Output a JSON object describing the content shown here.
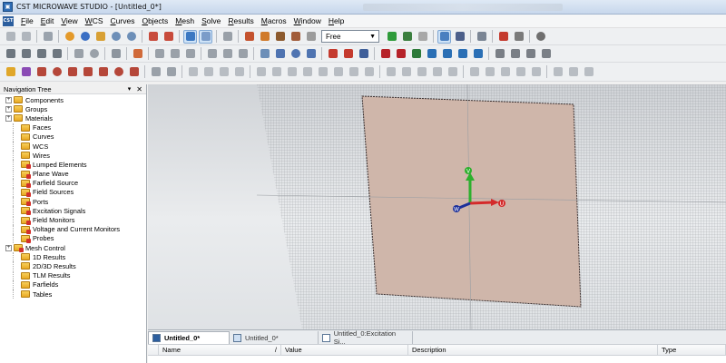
{
  "window": {
    "title": "CST MICROWAVE STUDIO - [Untitled_0*]",
    "app_icon": "cst-app-icon"
  },
  "menubar": {
    "items": [
      "File",
      "Edit",
      "View",
      "WCS",
      "Curves",
      "Objects",
      "Mesh",
      "Solve",
      "Results",
      "Macros",
      "Window",
      "Help"
    ]
  },
  "toolbar": {
    "view_mode_select": "Free"
  },
  "navigation_tree": {
    "title": "Navigation Tree",
    "items": [
      {
        "label": "Components",
        "expandable": true,
        "mark": false
      },
      {
        "label": "Groups",
        "expandable": true,
        "mark": false
      },
      {
        "label": "Materials",
        "expandable": true,
        "mark": false
      },
      {
        "label": "Faces",
        "expandable": false,
        "mark": false
      },
      {
        "label": "Curves",
        "expandable": false,
        "mark": false
      },
      {
        "label": "WCS",
        "expandable": false,
        "mark": false
      },
      {
        "label": "Wires",
        "expandable": false,
        "mark": false
      },
      {
        "label": "Lumped Elements",
        "expandable": false,
        "mark": true
      },
      {
        "label": "Plane Wave",
        "expandable": false,
        "mark": true
      },
      {
        "label": "Farfield Source",
        "expandable": false,
        "mark": true
      },
      {
        "label": "Field Sources",
        "expandable": false,
        "mark": true
      },
      {
        "label": "Ports",
        "expandable": false,
        "mark": true
      },
      {
        "label": "Excitation Signals",
        "expandable": false,
        "mark": true
      },
      {
        "label": "Field Monitors",
        "expandable": false,
        "mark": true
      },
      {
        "label": "Voltage and Current Monitors",
        "expandable": false,
        "mark": true
      },
      {
        "label": "Probes",
        "expandable": false,
        "mark": true
      },
      {
        "label": "Mesh Control",
        "expandable": true,
        "mark": true
      },
      {
        "label": "1D Results",
        "expandable": false,
        "mark": false
      },
      {
        "label": "2D/3D Results",
        "expandable": false,
        "mark": false
      },
      {
        "label": "TLM Results",
        "expandable": false,
        "mark": false
      },
      {
        "label": "Farfields",
        "expandable": false,
        "mark": false
      },
      {
        "label": "Tables",
        "expandable": false,
        "mark": false
      }
    ]
  },
  "viewport": {
    "axes": {
      "v": "V",
      "u": "U",
      "w": "W"
    },
    "colors": {
      "plate": "#cfb6aa",
      "axis_v": "#2db02d",
      "axis_u": "#d42a2a",
      "axis_w": "#1b2f9a"
    }
  },
  "document_tabs": [
    {
      "label": "Untitled_0*",
      "active": true
    },
    {
      "label": "Untitled_0*",
      "active": false
    },
    {
      "label": "Untitled_0:Excitation Si...",
      "active": false
    }
  ],
  "parameter_list": {
    "columns": [
      "Name",
      "/",
      "Value",
      "Description",
      "Type"
    ]
  }
}
